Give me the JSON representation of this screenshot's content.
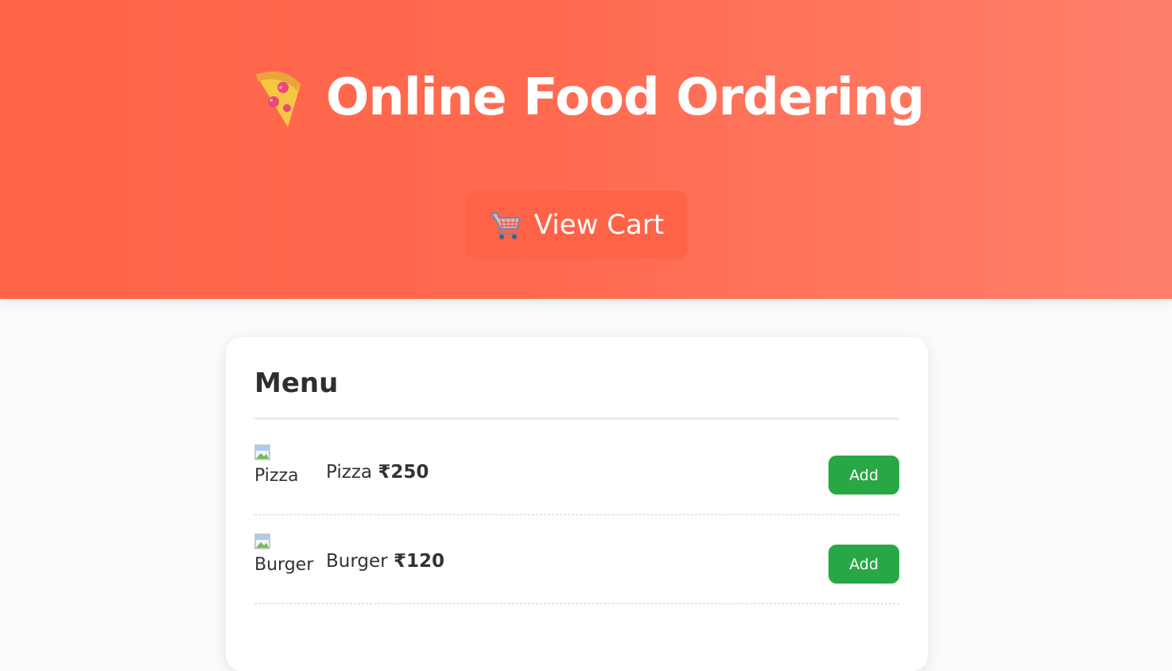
{
  "header": {
    "title": "Online Food Ordering",
    "title_icon": "pizza-icon",
    "cart_button": {
      "icon": "shopping-cart-icon",
      "label": "View Cart"
    },
    "gradient_colors": [
      "#ff6347",
      "#ff7f6b"
    ]
  },
  "menu": {
    "heading": "Menu",
    "items": [
      {
        "image_alt": "Pizza",
        "name": "Pizza",
        "price": "₹250",
        "add_label": "Add"
      },
      {
        "image_alt": "Burger",
        "name": "Burger",
        "price": "₹120",
        "add_label": "Add"
      }
    ]
  },
  "colors": {
    "accent": "#ff6347",
    "add_button": "#28a745",
    "background": "#fbfbfb"
  }
}
